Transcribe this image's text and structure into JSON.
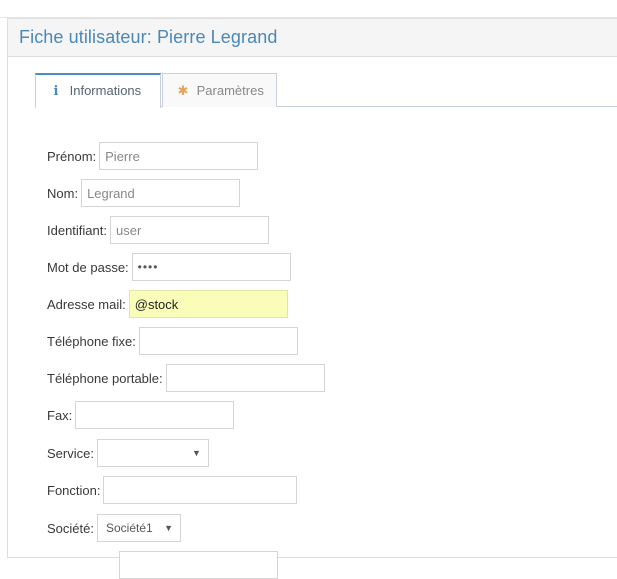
{
  "header": {
    "title": "Fiche utilisateur: Pierre Legrand"
  },
  "tabs": [
    {
      "label": "Informations",
      "icon": "info-icon",
      "active": true
    },
    {
      "label": "Paramètres",
      "icon": "gear-icon",
      "active": false
    }
  ],
  "form": {
    "prenom": {
      "label": "Prénom:",
      "value": "Pierre"
    },
    "nom": {
      "label": "Nom:",
      "value": "Legrand"
    },
    "identifiant": {
      "label": "Identifiant:",
      "value": "user"
    },
    "password": {
      "label": "Mot de passe:",
      "value": "••••"
    },
    "email": {
      "label": "Adresse mail:",
      "value": "@stock"
    },
    "tel_fixe": {
      "label": "Téléphone fixe:",
      "value": ""
    },
    "tel_portable": {
      "label": "Téléphone portable:",
      "value": ""
    },
    "fax": {
      "label": "Fax:",
      "value": ""
    },
    "service": {
      "label": "Service:",
      "value": ""
    },
    "fonction": {
      "label": "Fonction:",
      "value": ""
    },
    "societe": {
      "label": "Société:",
      "value": "Société1"
    }
  },
  "colors": {
    "title": "#4a88b8",
    "active_tab_border": "#4c8fbd",
    "autofill_bg": "#fafdb8",
    "gear_icon": "#e8a35a"
  }
}
